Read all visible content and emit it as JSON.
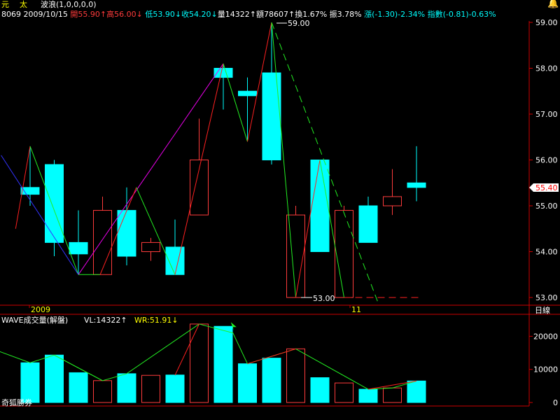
{
  "header": {
    "stock_char_1": "元",
    "stock_char_2": "太",
    "indicator_label": "波浪(1,0,0,0,0)",
    "info": {
      "code": "8069",
      "date": "2009/10/15",
      "open": "開55.90↑",
      "high": "高56.00↓",
      "low": "低53.90↓",
      "close": "收54.20↓",
      "volume": "量14322↑",
      "amount": "額78607↑",
      "turnover": "換1.67%",
      "amplitude": "振3.78%",
      "change": "漲(-1.30)-2.34%",
      "index": "指數(-0.81)-0.63%"
    }
  },
  "price_labels": {
    "high_marker": "59.00",
    "low_marker": "53.00",
    "current_price": "55.40"
  },
  "x_axis": {
    "year_label": "2009",
    "month_label": "11",
    "period_label": "日線"
  },
  "volume_panel": {
    "title": "WAVE成交量(解盤)",
    "vl": "VL:14322↑",
    "wr": "WR:51.91↓",
    "y_ticks": [
      "20000",
      "10000",
      "0"
    ]
  },
  "watermark": "奇狐勝券",
  "icons": {
    "alert": "bell-icon"
  },
  "colors": {
    "up": "#ff3b3b",
    "down": "#00ffff",
    "wave_up": "#ff2020",
    "wave_down": "#22ee22",
    "wave_alt": "#ee00ee",
    "wave_blue": "#3333ff",
    "axis": "#cc0000",
    "label": "#ffffff",
    "yellow": "#ffff00"
  },
  "chart_data": [
    {
      "type": "candlestick",
      "title": "",
      "y_ticks": [
        53.0,
        54.0,
        55.0,
        56.0,
        57.0,
        58.0,
        59.0
      ],
      "ylim": [
        52.9,
        59.1
      ],
      "candles": [
        {
          "o": 55.4,
          "h": 56.3,
          "l": 55.0,
          "c": 55.25
        },
        {
          "o": 55.9,
          "h": 56.0,
          "l": 53.9,
          "c": 54.2
        },
        {
          "o": 54.2,
          "h": 54.9,
          "l": 53.5,
          "c": 53.95
        },
        {
          "o": 53.5,
          "h": 55.2,
          "l": 53.5,
          "c": 54.9
        },
        {
          "o": 54.9,
          "h": 55.4,
          "l": 53.7,
          "c": 53.9
        },
        {
          "o": 54.0,
          "h": 54.3,
          "l": 53.8,
          "c": 54.2
        },
        {
          "o": 54.1,
          "h": 54.7,
          "l": 53.5,
          "c": 53.5
        },
        {
          "o": 54.8,
          "h": 56.9,
          "l": 54.8,
          "c": 56.0
        },
        {
          "o": 58.0,
          "h": 58.1,
          "l": 57.1,
          "c": 57.8
        },
        {
          "o": 57.5,
          "h": 57.8,
          "l": 56.4,
          "c": 57.4
        },
        {
          "o": 57.9,
          "h": 59.0,
          "l": 55.9,
          "c": 56.0
        },
        {
          "o": 53.0,
          "h": 55.0,
          "l": 53.0,
          "c": 54.8
        },
        {
          "o": 56.0,
          "h": 56.0,
          "l": 54.0,
          "c": 54.0
        },
        {
          "o": 53.0,
          "h": 55.0,
          "l": 53.0,
          "c": 54.9
        },
        {
          "o": 55.0,
          "h": 55.2,
          "l": 54.2,
          "c": 54.2
        },
        {
          "o": 55.0,
          "h": 55.8,
          "l": 54.8,
          "c": 55.2
        },
        {
          "o": 55.5,
          "h": 56.3,
          "l": 55.1,
          "c": 55.4
        }
      ],
      "wave_lines": [
        {
          "color": "#ff2020",
          "points": [
            [
              -0.6,
              54.5
            ],
            [
              0,
              56.3
            ]
          ]
        },
        {
          "color": "#22ee22",
          "points": [
            [
              0,
              56.3
            ],
            [
              2,
              53.5
            ]
          ]
        },
        {
          "color": "#3333ff",
          "points": [
            [
              -1.2,
              56.1
            ],
            [
              2,
              53.5
            ]
          ]
        },
        {
          "color": "#ee00ee",
          "points": [
            [
              2,
              53.5
            ],
            [
              8,
              58.1
            ]
          ]
        },
        {
          "color": "#22ee22",
          "points": [
            [
              2,
              53.5
            ],
            [
              2.9,
              53.5
            ]
          ]
        },
        {
          "color": "#ff2020",
          "points": [
            [
              2.9,
              53.5
            ],
            [
              4.4,
              55.4
            ]
          ]
        },
        {
          "color": "#22ee22",
          "points": [
            [
              4.4,
              55.4
            ],
            [
              6,
              53.5
            ]
          ]
        },
        {
          "color": "#ff2020",
          "points": [
            [
              6,
              53.5
            ],
            [
              8,
              58.1
            ]
          ]
        },
        {
          "color": "#22ee22",
          "points": [
            [
              8,
              58.1
            ],
            [
              9,
              56.4
            ]
          ]
        },
        {
          "color": "#ff2020",
          "points": [
            [
              9,
              56.4
            ],
            [
              10,
              59.0
            ]
          ]
        },
        {
          "color": "#22ee22",
          "points": [
            [
              10,
              59.0
            ],
            [
              11,
              53.0
            ]
          ]
        },
        {
          "color": "#ff2020",
          "points": [
            [
              11,
              53.0
            ],
            [
              12,
              56.0
            ]
          ]
        },
        {
          "color": "#22ee22",
          "points": [
            [
              12,
              56.0
            ],
            [
              13,
              53.0
            ]
          ]
        }
      ],
      "projection_lines": [
        {
          "color": "#22ee22",
          "points": [
            [
              10,
              59.0
            ],
            [
              14.4,
              52.9
            ]
          ]
        },
        {
          "color": "#ff2020",
          "points": [
            [
              13,
              53.0
            ],
            [
              16.2,
              53.0
            ]
          ]
        }
      ]
    },
    {
      "type": "bar",
      "title": "WAVE成交量(解盤)",
      "y_ticks": [
        0,
        10000,
        20000
      ],
      "ylim": [
        0,
        25000
      ],
      "values": [
        12000,
        14322,
        9000,
        6600,
        8700,
        8200,
        8300,
        23700,
        23000,
        11700,
        13400,
        16200,
        7500,
        5900,
        4000,
        4400,
        6500
      ],
      "wave_line": {
        "color": "#22ee22",
        "points": [
          [
            -1.3,
            15500
          ],
          [
            0,
            12000
          ],
          [
            1,
            14322
          ],
          [
            3,
            6600
          ],
          [
            4,
            8700
          ],
          [
            7,
            23700
          ],
          [
            8.4,
            21000
          ],
          [
            9,
            11700
          ],
          [
            11,
            16200
          ],
          [
            14,
            4000
          ],
          [
            15,
            4400
          ],
          [
            16,
            6500
          ]
        ]
      },
      "wave_line_up": {
        "color": "#ff2020",
        "points": [
          [
            6,
            8200
          ],
          [
            7,
            23700
          ]
        ]
      },
      "arrow_x": 8.4
    }
  ]
}
